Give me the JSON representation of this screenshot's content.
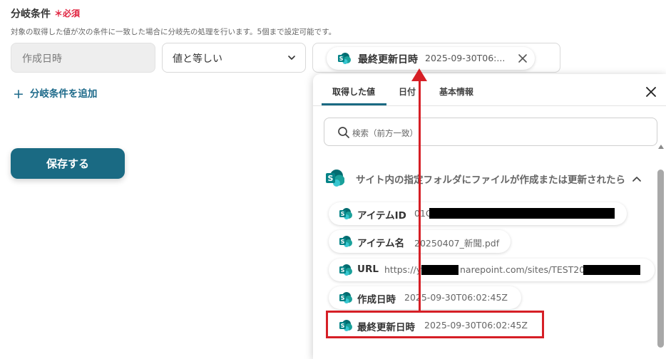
{
  "header": {
    "title": "分岐条件",
    "required": "＊必須",
    "description": "対象の取得した値が次の条件に一致した場合に分岐先の処理を行います。5個まで設定可能です。"
  },
  "condition": {
    "left_field": "作成日時",
    "operator": "値と等しい",
    "value_chip": {
      "label": "最終更新日時",
      "value": "2025-09-30T06:..."
    }
  },
  "add_condition_label": "分岐条件を追加",
  "save_label": "保存する",
  "panel": {
    "tabs": [
      "取得した値",
      "日付",
      "基本情報"
    ],
    "active_tab": 0,
    "search_placeholder": "検索（前方一致）",
    "group_label": "サイト内の指定フォルダにファイルが作成または更新されたら",
    "items": [
      {
        "key": "アイテムID",
        "value": "01G"
      },
      {
        "key": "アイテム名",
        "value": "20250407_新聞.pdf"
      },
      {
        "key": "URL",
        "value_a": "https://y",
        "value_b": "narepoint.com/sites/TEST2025/"
      },
      {
        "key": "作成日時",
        "value": "2025-09-30T06:02:45Z"
      },
      {
        "key": "最終更新日時",
        "value": "2025-09-30T06:02:45Z"
      }
    ]
  },
  "colors": {
    "accent": "#1a6a83",
    "required": "#e0233f",
    "annotation": "#d61f26",
    "sharepoint_teal": "#1aa19b",
    "sharepoint_dark": "#036c70"
  }
}
